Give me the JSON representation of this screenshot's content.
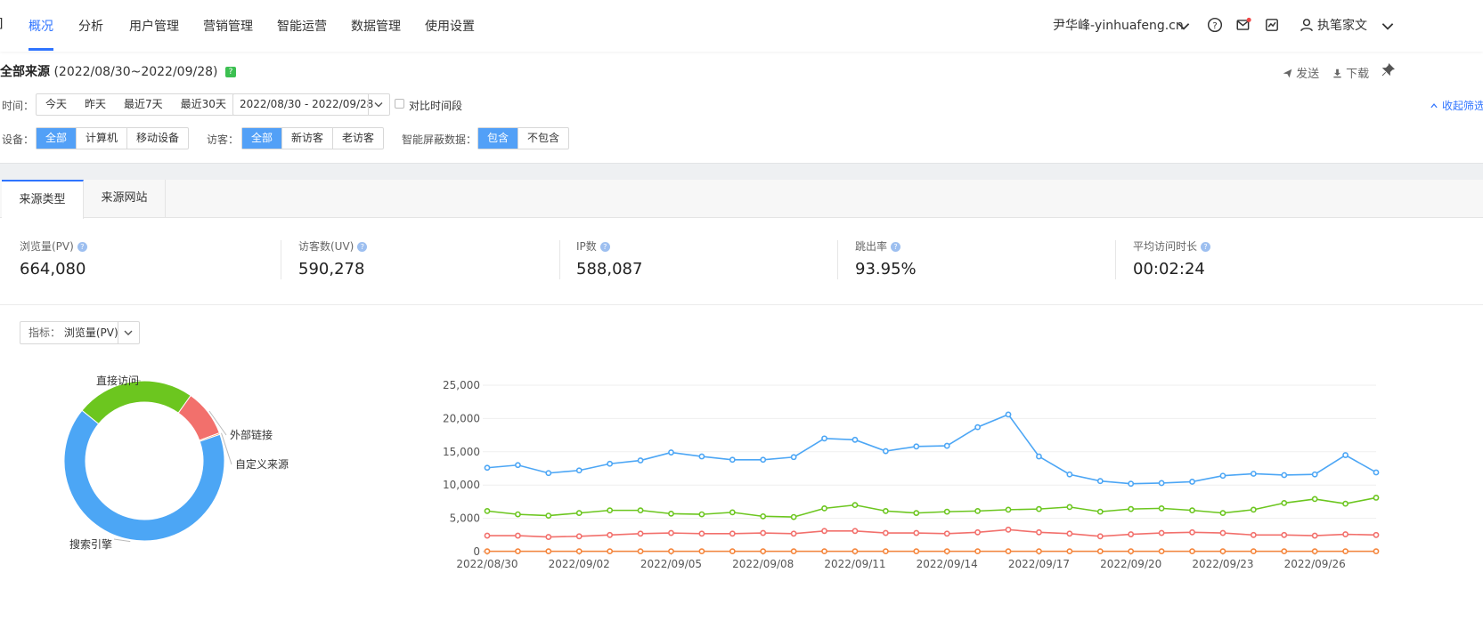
{
  "nav": {
    "edge_fragment": "]",
    "items": [
      "概况",
      "分析",
      "用户管理",
      "营销管理",
      "智能运营",
      "数据管理",
      "使用设置"
    ],
    "active_index": 0,
    "site": "尹华峰-yinhuafeng.cn",
    "user": "执笔家文"
  },
  "header": {
    "title": "全部来源",
    "range": "(2022/08/30~2022/09/28)",
    "help": "?",
    "send": "发送",
    "download": "下载"
  },
  "filters": {
    "time_label": "时间：",
    "time_options": [
      "今天",
      "昨天",
      "最近7天",
      "最近30天"
    ],
    "date_range": "2022/08/30 - 2022/09/28",
    "compare_label": "对比时间段",
    "collapse": "收起筛选",
    "device_label": "设备：",
    "device_options": [
      "全部",
      "计算机",
      "移动设备"
    ],
    "visitor_label": "访客：",
    "visitor_options": [
      "全部",
      "新访客",
      "老访客"
    ],
    "smart_label": "智能屏蔽数据：",
    "smart_options": [
      "包含",
      "不包含"
    ]
  },
  "tabs": [
    "来源类型",
    "来源网站"
  ],
  "metrics": [
    {
      "label": "浏览量(PV)",
      "value": "664,080"
    },
    {
      "label": "访客数(UV)",
      "value": "590,278"
    },
    {
      "label": "IP数",
      "value": "588,087"
    },
    {
      "label": "跳出率",
      "value": "93.95%"
    },
    {
      "label": "平均访问时长",
      "value": "00:02:24"
    }
  ],
  "indicator": {
    "label": "指标：",
    "value": "浏览量(PV)"
  },
  "colors": {
    "accent": "#2f74ff",
    "blue": "#4ca6f5",
    "green": "#6cc61f",
    "red": "#f2706c",
    "orange": "#f5853b"
  },
  "chart_data": [
    {
      "type": "pie",
      "donut": true,
      "slices": [
        {
          "label": "直接访问",
          "value": 24,
          "color": "#6cc61f"
        },
        {
          "label": "外部链接",
          "value": 9.5,
          "color": "#f2706c"
        },
        {
          "label": "自定义来源",
          "value": 0.3,
          "color": "#f5853b"
        },
        {
          "label": "搜索引擎",
          "value": 66.2,
          "color": "#4ca6f5"
        }
      ]
    },
    {
      "type": "line",
      "ylim": [
        0,
        25000
      ],
      "yticks": [
        "0",
        "5,000",
        "10,000",
        "15,000",
        "20,000",
        "25,000"
      ],
      "x": [
        "2022/08/30",
        "2022/08/31",
        "2022/09/01",
        "2022/09/02",
        "2022/09/03",
        "2022/09/04",
        "2022/09/05",
        "2022/09/06",
        "2022/09/07",
        "2022/09/08",
        "2022/09/09",
        "2022/09/10",
        "2022/09/11",
        "2022/09/12",
        "2022/09/13",
        "2022/09/14",
        "2022/09/15",
        "2022/09/16",
        "2022/09/17",
        "2022/09/18",
        "2022/09/19",
        "2022/09/20",
        "2022/09/21",
        "2022/09/22",
        "2022/09/23",
        "2022/09/24",
        "2022/09/25",
        "2022/09/26",
        "2022/09/27",
        "2022/09/28"
      ],
      "xticks": [
        "2022/08/30",
        "2022/09/02",
        "2022/09/05",
        "2022/09/08",
        "2022/09/11",
        "2022/09/14",
        "2022/09/17",
        "2022/09/20",
        "2022/09/23",
        "2022/09/26"
      ],
      "series": [
        {
          "color": "#4ca6f5",
          "values": [
            12600,
            13000,
            11800,
            12200,
            13200,
            13700,
            14900,
            14300,
            13800,
            13800,
            14200,
            17000,
            16800,
            15100,
            15800,
            15900,
            18700,
            20600,
            14300,
            11600,
            10600,
            10200,
            10300,
            10500,
            11400,
            11700,
            11500,
            11600,
            14500,
            11900
          ]
        },
        {
          "color": "#6cc61f",
          "values": [
            6100,
            5600,
            5400,
            5800,
            6200,
            6200,
            5700,
            5600,
            5900,
            5300,
            5200,
            6500,
            7000,
            6100,
            5800,
            6000,
            6100,
            6300,
            6400,
            6700,
            6000,
            6400,
            6500,
            6200,
            5800,
            6300,
            7300,
            7900,
            7200,
            8100
          ]
        },
        {
          "color": "#f2706c",
          "values": [
            2400,
            2400,
            2200,
            2300,
            2500,
            2700,
            2800,
            2700,
            2700,
            2800,
            2700,
            3100,
            3100,
            2800,
            2800,
            2700,
            2900,
            3300,
            2900,
            2700,
            2300,
            2600,
            2800,
            2900,
            2800,
            2500,
            2500,
            2400,
            2600,
            2500
          ]
        },
        {
          "color": "#f5853b",
          "values": [
            50,
            50,
            50,
            50,
            50,
            50,
            50,
            50,
            50,
            50,
            50,
            50,
            50,
            50,
            50,
            50,
            50,
            50,
            50,
            50,
            50,
            50,
            50,
            50,
            50,
            50,
            50,
            50,
            50,
            50
          ]
        }
      ]
    }
  ]
}
